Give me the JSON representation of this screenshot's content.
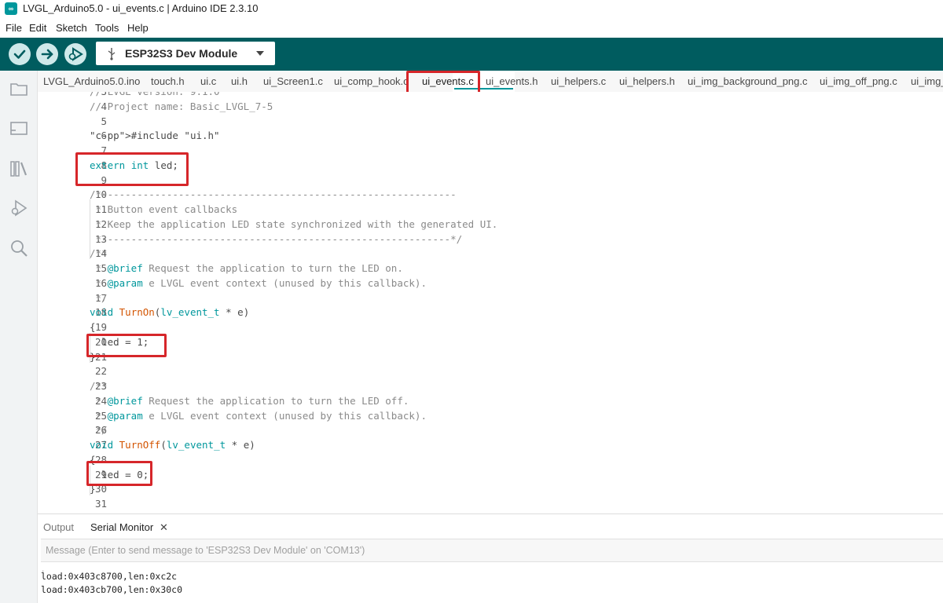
{
  "window": {
    "title": "LVGL_Arduino5.0 - ui_events.c | Arduino IDE 2.3.10",
    "logo_text": "∞"
  },
  "menu": [
    "File",
    "Edit",
    "Sketch",
    "Tools",
    "Help"
  ],
  "toolbar": {
    "verify_icon": "check-icon",
    "upload_icon": "arrow-right-icon",
    "debug_icon": "debug-icon",
    "board": "ESP32S3 Dev Module"
  },
  "sidebar_icons": [
    "folder-icon",
    "board-icon",
    "library-icon",
    "debug-icon",
    "search-icon"
  ],
  "tabs": [
    "LVGL_Arduino5.0.ino",
    "touch.h",
    "ui.c",
    "ui.h",
    "ui_Screen1.c",
    "ui_comp_hook.c",
    "ui_events.c",
    "ui_events.h",
    "ui_helpers.c",
    "ui_helpers.h",
    "ui_img_background_png.c",
    "ui_img_off_png.c",
    "ui_img_"
  ],
  "active_tab": "ui_events.c",
  "code_lines": [
    {
      "n": "3",
      "text": "// LVGL version: 9.1.0"
    },
    {
      "n": "4",
      "text": "// Project name: Basic_LVGL_7-5"
    },
    {
      "n": "5",
      "text": ""
    },
    {
      "n": "6",
      "text": "#include \"ui.h\""
    },
    {
      "n": "7",
      "text": ""
    },
    {
      "n": "8",
      "text": "extern int led;"
    },
    {
      "n": "9",
      "text": ""
    },
    {
      "n": "10",
      "text": "/*------------------------------------------------------------"
    },
    {
      "n": "11",
      "text": " * Button event callbacks"
    },
    {
      "n": "12",
      "text": " * Keep the application LED state synchronized with the generated UI."
    },
    {
      "n": "13",
      "text": " *-----------------------------------------------------------*/"
    },
    {
      "n": "14",
      "text": "/**"
    },
    {
      "n": "15",
      "text": " * @brief Request the application to turn the LED on."
    },
    {
      "n": "16",
      "text": " * @param e LVGL event context (unused by this callback)."
    },
    {
      "n": "17",
      "text": " */"
    },
    {
      "n": "18",
      "text": "void TurnOn(lv_event_t * e)"
    },
    {
      "n": "19",
      "text": "{"
    },
    {
      "n": "20",
      "text": "  led = 1;"
    },
    {
      "n": "21",
      "text": "}"
    },
    {
      "n": "22",
      "text": ""
    },
    {
      "n": "23",
      "text": "/**"
    },
    {
      "n": "24",
      "text": " * @brief Request the application to turn the LED off."
    },
    {
      "n": "25",
      "text": " * @param e LVGL event context (unused by this callback)."
    },
    {
      "n": "26",
      "text": " */"
    },
    {
      "n": "27",
      "text": "void TurnOff(lv_event_t * e)"
    },
    {
      "n": "28",
      "text": "{"
    },
    {
      "n": "29",
      "text": "  led = 0;"
    },
    {
      "n": "30",
      "text": "}"
    },
    {
      "n": "31",
      "text": ""
    }
  ],
  "bottom_panel": {
    "tabs": [
      "Output",
      "Serial Monitor"
    ],
    "active": "Serial Monitor",
    "close_glyph": "✕",
    "message_placeholder": "Message (Enter to send message to 'ESP32S3 Dev Module' on 'COM13')",
    "serial_lines": [
      "load:0x403c8700,len:0xc2c",
      "load:0x403cb700,len:0x30c0"
    ]
  },
  "colors": {
    "accent": "#00979c",
    "toolbar": "#005c5f",
    "highlight_box": "#d6262a"
  }
}
